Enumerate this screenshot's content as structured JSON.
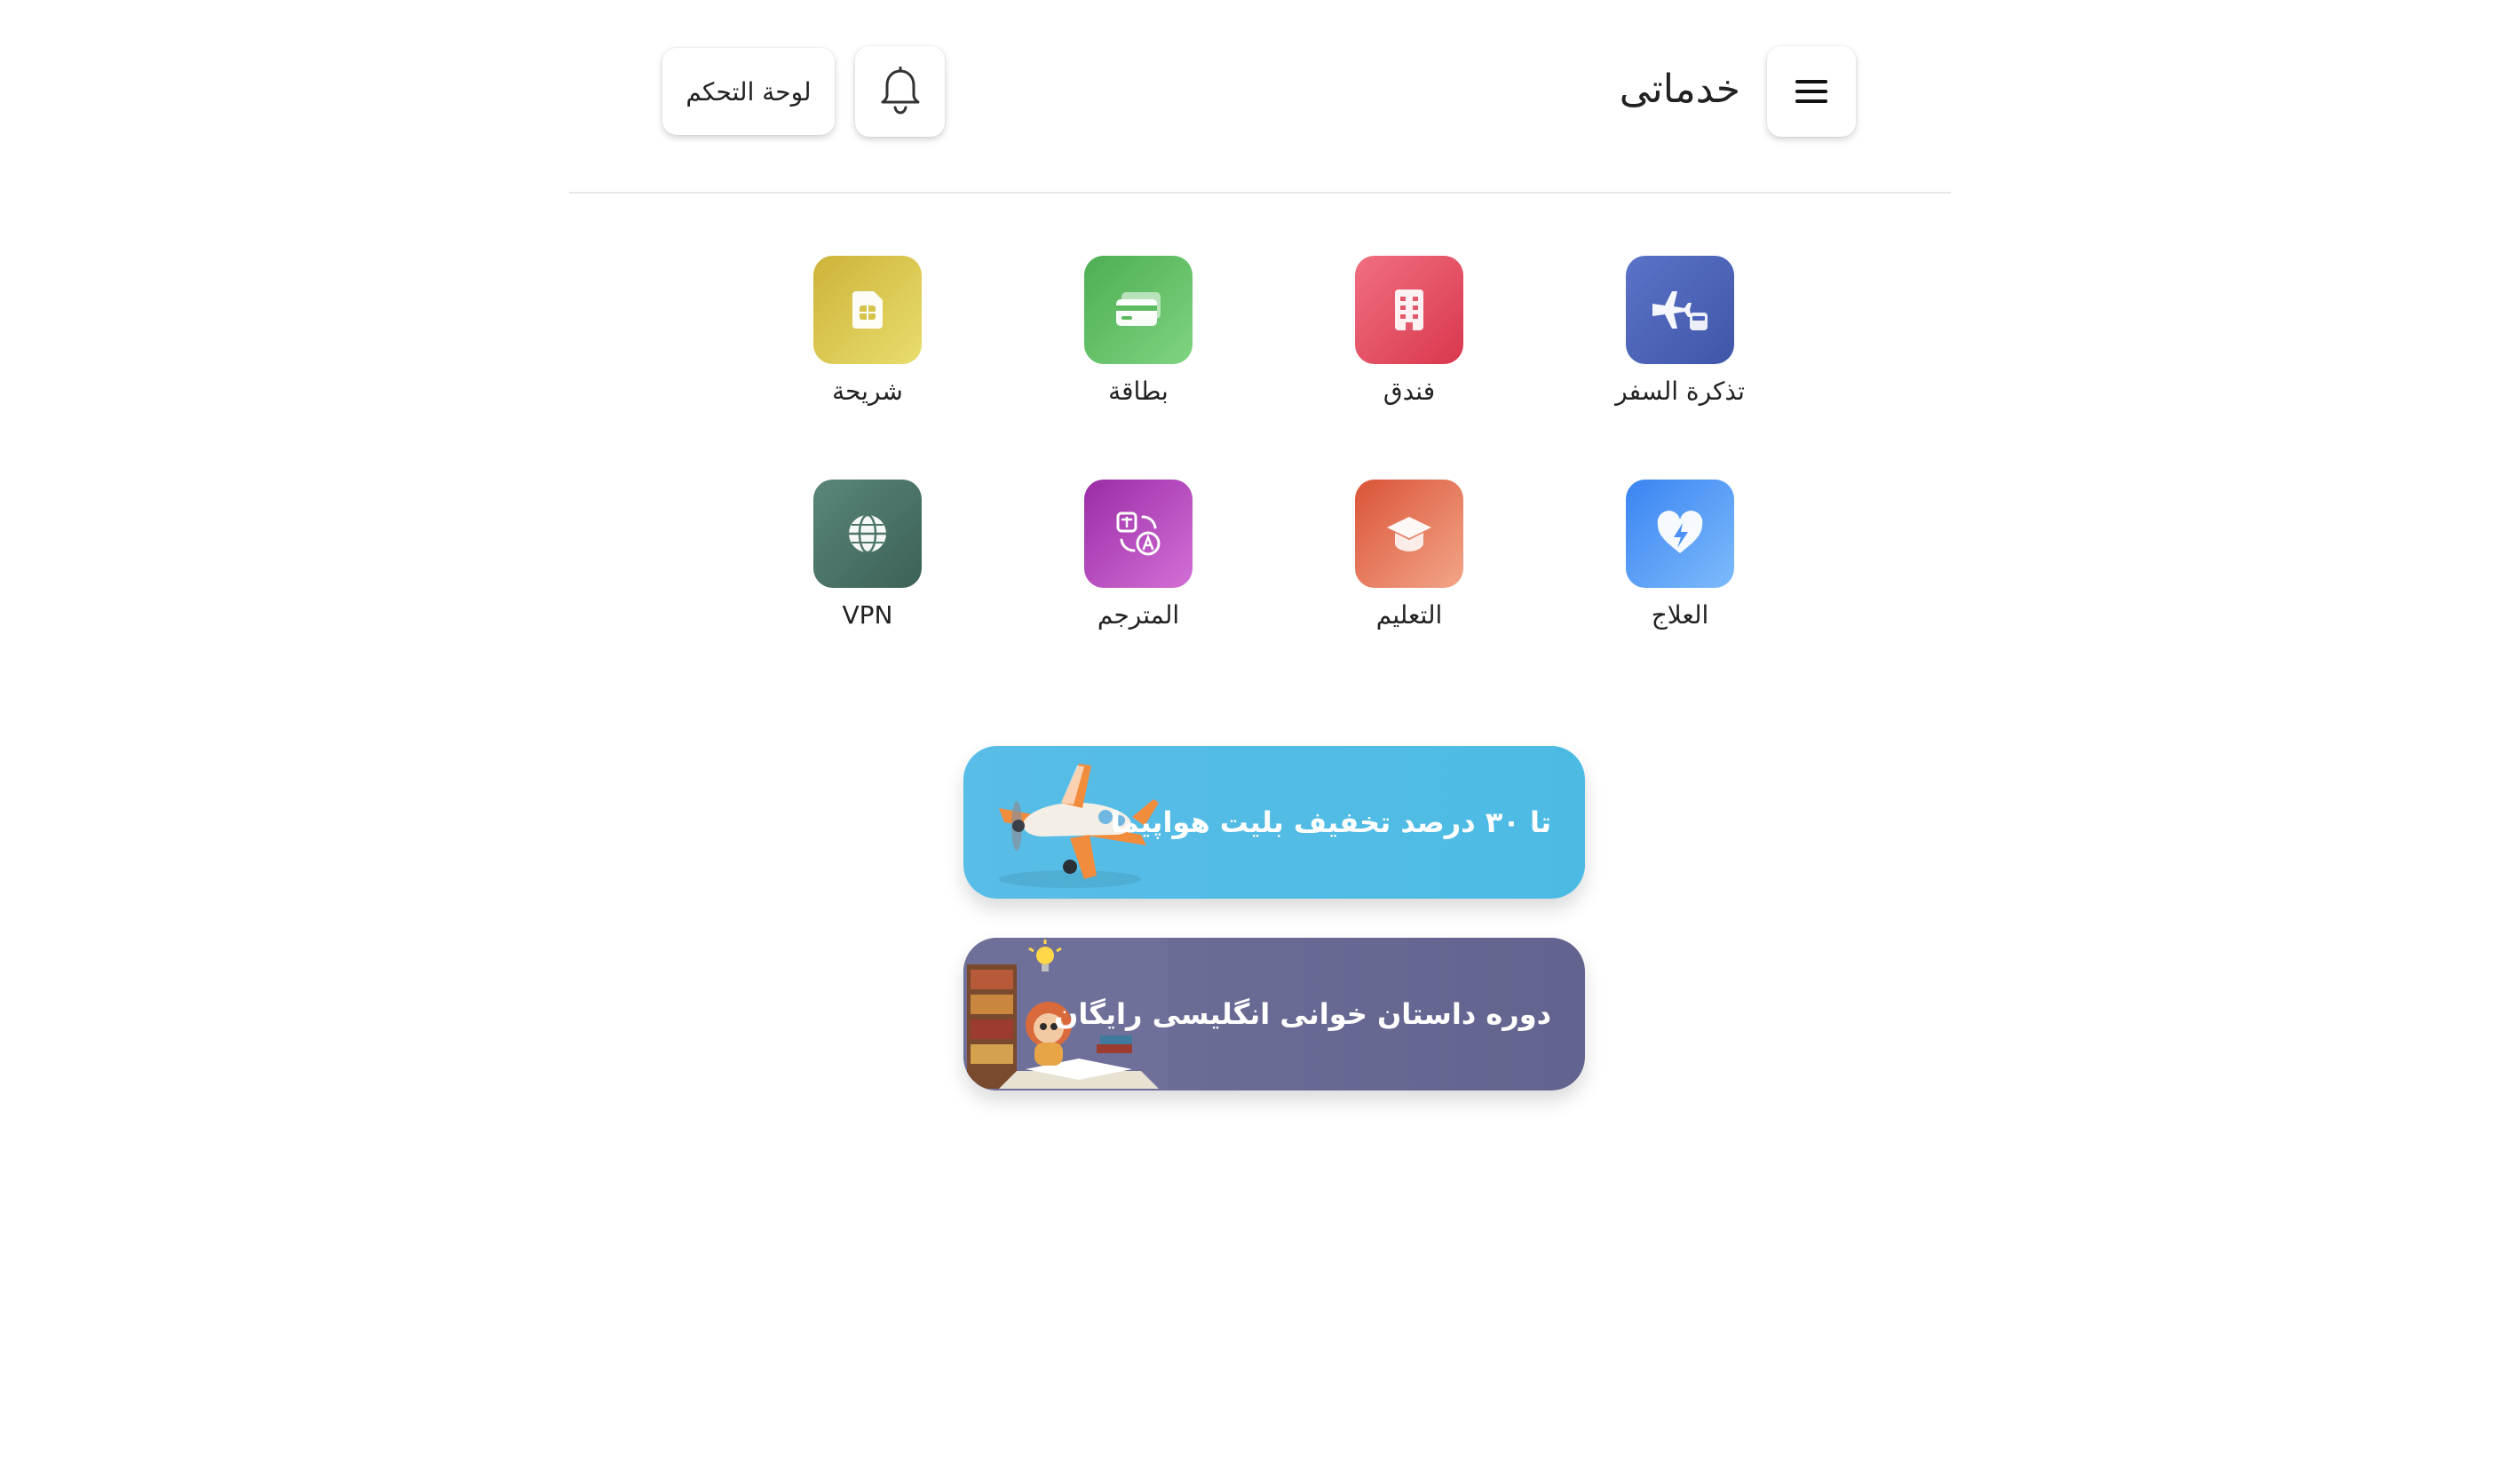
{
  "header": {
    "title": "خدماتی",
    "dashboard_label": "لوحة التحكم",
    "menu_icon": "hamburger-menu-icon",
    "notification_icon": "bell-icon"
  },
  "services": [
    {
      "label": "تذكرة السفر",
      "icon": "plane-train-icon",
      "color_from": "#5b73c8",
      "color_to": "#3f56a8"
    },
    {
      "label": "فندق",
      "icon": "hotel-building-icon",
      "color_from": "#f07080",
      "color_to": "#d9374d"
    },
    {
      "label": "بطاقة",
      "icon": "credit-card-icon",
      "color_from": "#55b85a",
      "color_to": "#7fd37f"
    },
    {
      "label": "شريحة",
      "icon": "sim-card-icon",
      "color_from": "#d2b63a",
      "color_to": "#e8dc6a"
    },
    {
      "label": "العلاج",
      "icon": "heart-pulse-icon",
      "color_from": "#3f8af3",
      "color_to": "#7ab9fb"
    },
    {
      "label": "التعليم",
      "icon": "graduation-cap-icon",
      "color_from": "#df5a3e",
      "color_to": "#f0a083"
    },
    {
      "label": "المترجم",
      "icon": "translate-icon",
      "color_from": "#9c2fa8",
      "color_to": "#d06ad3"
    },
    {
      "label": "VPN",
      "icon": "globe-icon",
      "color_from": "#4f7a6e",
      "color_to": "#3c5f55"
    }
  ],
  "banners": [
    {
      "text": "تا ۳۰ درصد تخفیف بلیت هواپیما",
      "art": "toy-airplane-illustration",
      "color": "#52bce5"
    },
    {
      "text": "دوره داستان خوانی انگلیسی رایگان",
      "art": "reading-girl-books-illustration",
      "color": "#686a93"
    }
  ]
}
